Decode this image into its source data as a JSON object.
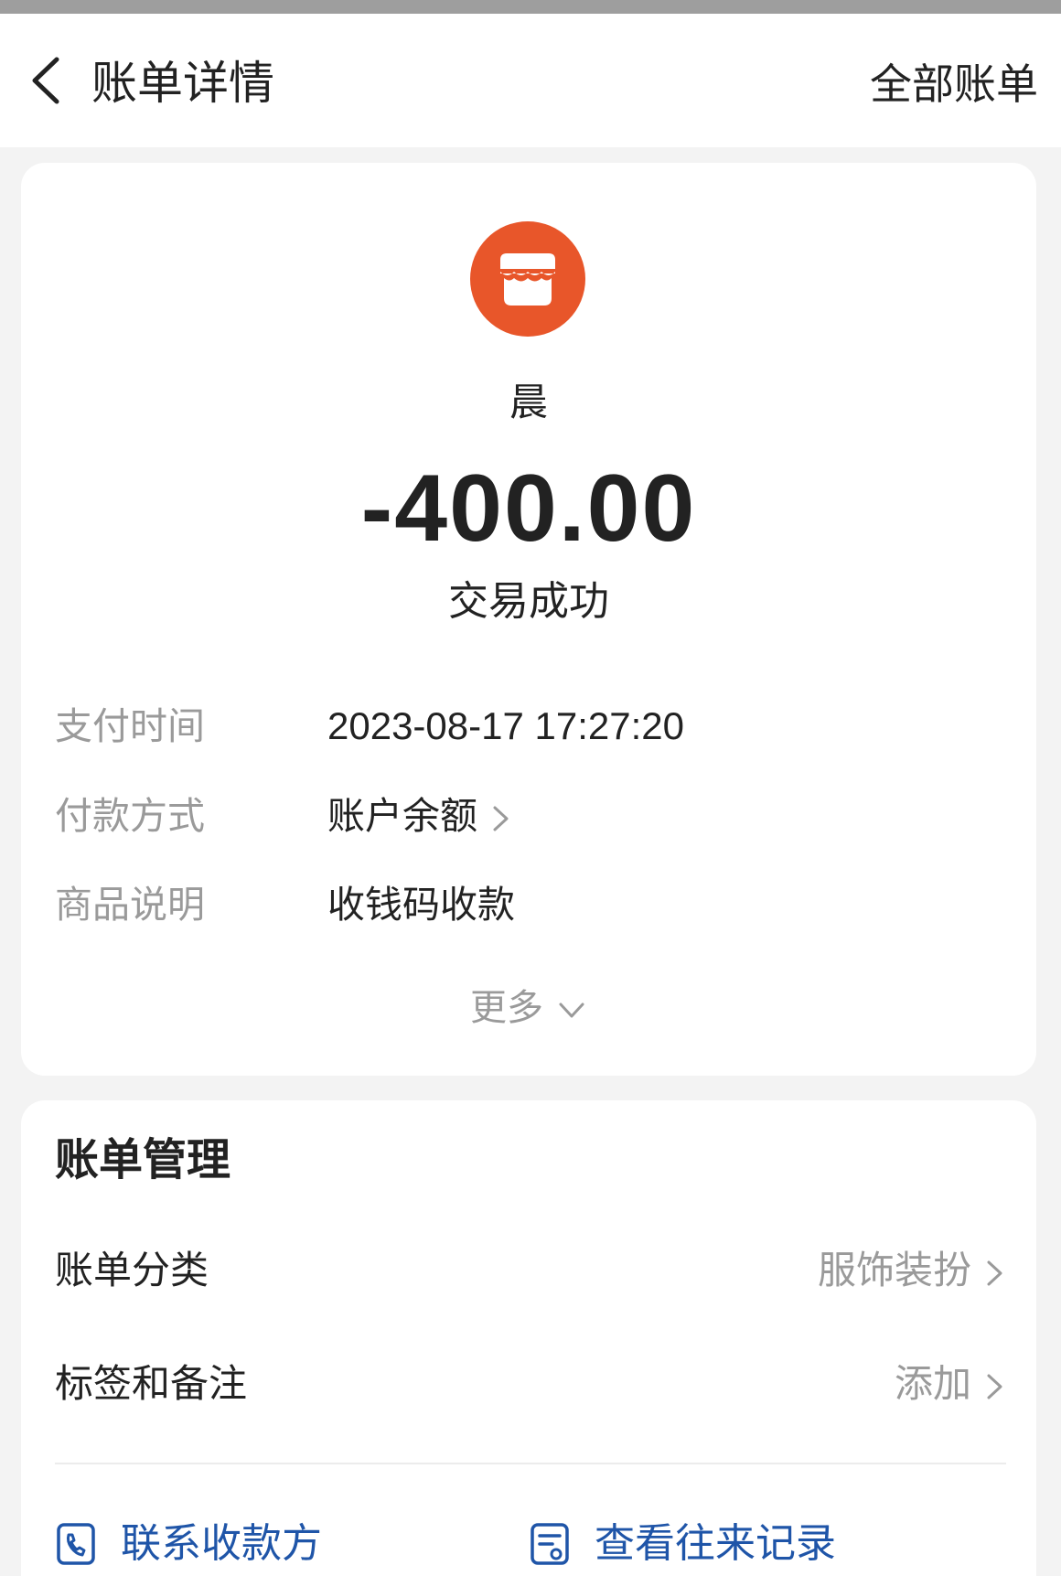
{
  "header": {
    "title": "账单详情",
    "right_link": "全部账单"
  },
  "transaction": {
    "merchant_icon": "store-icon",
    "merchant_name": "晨",
    "amount": "-400.00",
    "status": "交易成功",
    "details": [
      {
        "label": "支付时间",
        "value": "2023-08-17 17:27:20"
      },
      {
        "label": "付款方式",
        "value": "账户余额"
      },
      {
        "label": "商品说明",
        "value": "收钱码收款"
      }
    ],
    "more_label": "更多"
  },
  "management": {
    "title": "账单管理",
    "rows": [
      {
        "label": "账单分类",
        "value": "服饰装扮"
      },
      {
        "label": "标签和备注",
        "value": "添加"
      }
    ],
    "actions": [
      {
        "label": "联系收款方",
        "icon": "phone-icon"
      },
      {
        "label": "查看往来记录",
        "icon": "record-icon"
      }
    ]
  },
  "colors": {
    "accent": "#e8562a",
    "link": "#1f55a8",
    "muted_text": "#9a9a9a"
  }
}
